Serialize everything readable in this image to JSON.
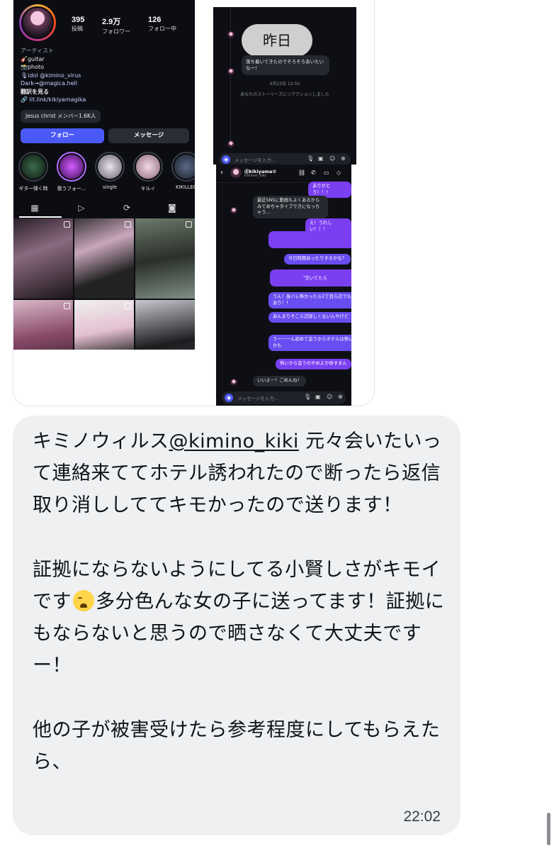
{
  "attachment": {
    "profile": {
      "stats": [
        {
          "value": "395",
          "label": "投稿"
        },
        {
          "value": "2.9万",
          "label": "フォロワー"
        },
        {
          "value": "126",
          "label": "フォロー中"
        }
      ],
      "category": "アーティスト",
      "bio_lines": [
        "🎸guitar",
        "📸photo",
        "🎙idol @kimino_virus",
        "Dark→@magica.hell"
      ],
      "translate": "翻訳を見る",
      "link": "lit.link/kikiyamagika",
      "chip": "Jesus christ メンバー1.6K人",
      "follow_button": "フォロー",
      "message_button": "メッセージ",
      "highlights": [
        "ギター弾く時",
        "歌うフォー...",
        "single",
        "キルイ",
        "KIKILLEG"
      ]
    },
    "dm_top": {
      "yesterday_label": "昨日",
      "message": "落ち着いてきたのでそろそろあいたいなー！",
      "timestamp": "4月23日 12:55",
      "reaction_note": "あなたのストーリーズにリアクションしました",
      "composer_placeholder": "メッセージを入力..."
    },
    "dm_bottom": {
      "name": "Ⓚkikiyama⚙",
      "username": "kimino_kiki",
      "messages": [
        {
          "dir": "out",
          "text": "ありがとう！！！"
        },
        {
          "dir": "in",
          "text": "最近SNSに動画もよくあるからみてめちゃタイプできになっちゃう..."
        },
        {
          "dir": "out",
          "text": "え！うれしい！！！"
        },
        {
          "dir": "out",
          "text": ""
        },
        {
          "dir": "out",
          "text": "今日時間あったりするかな？"
        },
        {
          "dir": "out",
          "text": "〝空いてたら"
        },
        {
          "dir": "out",
          "text": "うん！身バレ怖かったら2丁目ら辺でもあり！！"
        },
        {
          "dir": "out",
          "text": "あんまりそこら辺詳しくないんやけど"
        },
        {
          "dir": "out",
          "text": "うーーーん初めて会うからホテルは怖いかも"
        },
        {
          "dir": "out",
          "text": "怖いから会うのやめよか😅すまん"
        },
        {
          "dir": "in",
          "text": "いいよー！ごめんね！"
        }
      ],
      "composer_placeholder": "メッセージを入力..."
    }
  },
  "message": {
    "mention": "@kimino_kiki",
    "prefix": "キミノウィルス",
    "para1_rest": " 元々会いたいって連絡来ててホテル誘われたので断ったら返信取り消ししててキモかったので送ります！",
    "para2_a": "証拠にならないようにしてる小賢しさがキモイです",
    "emoji": "😭",
    "para2_b": "多分色んな女の子に送ってます！証拠にもならないと思うので晒さなくて大丈夫ですー！",
    "para3": "他の子が被害受けたら参考程度にしてもらえたら、",
    "time": "22:02"
  },
  "colors": {
    "accent_blue": "#4b5af6",
    "dm_purple": "#7b3ff2",
    "bubble_bg": "#eef0f2"
  }
}
